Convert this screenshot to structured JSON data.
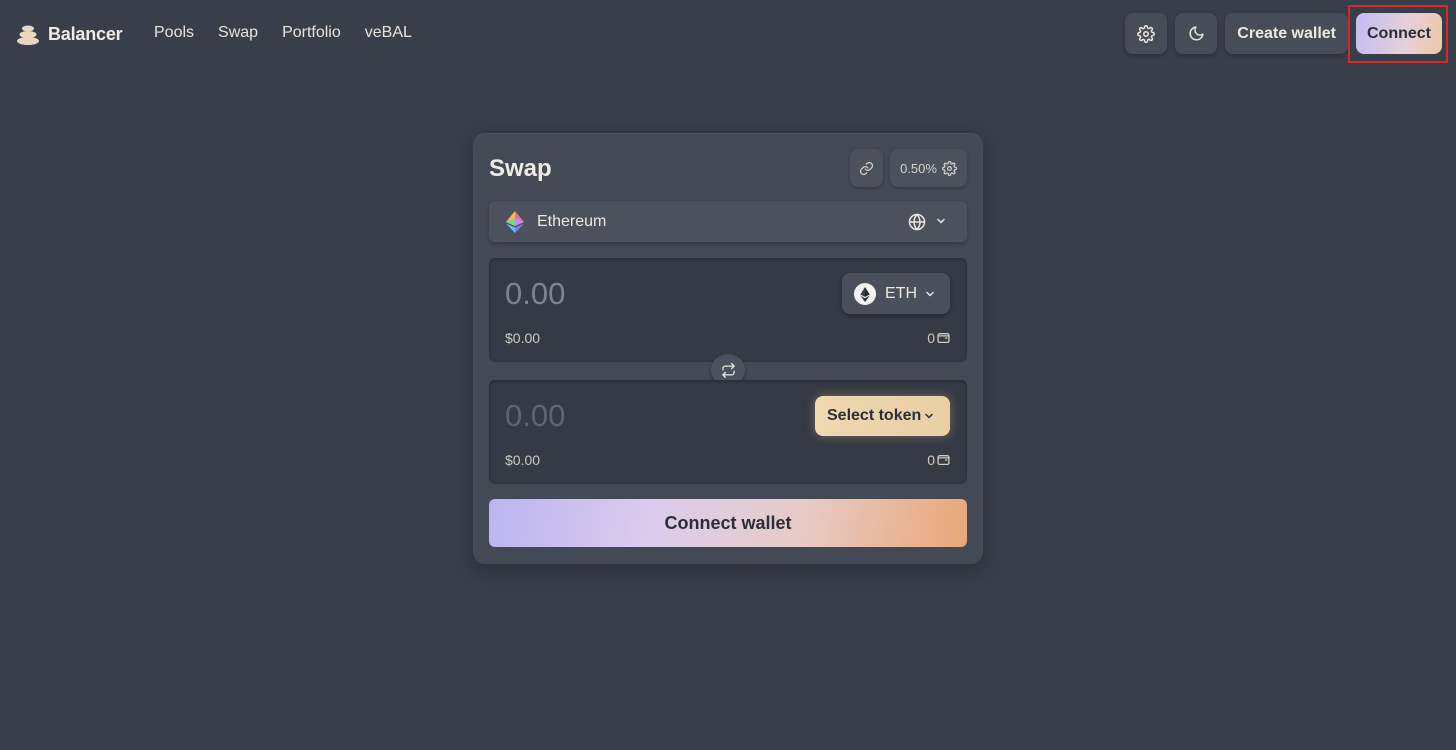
{
  "header": {
    "brand": "Balancer",
    "nav": [
      "Pools",
      "Swap",
      "Portfolio",
      "veBAL"
    ],
    "create_wallet_label": "Create wallet",
    "connect_label": "Connect"
  },
  "swap": {
    "title": "Swap",
    "slippage": "0.50%",
    "network": "Ethereum",
    "from": {
      "amount_placeholder": "0.00",
      "usd": "$0.00",
      "balance": "0",
      "token": "ETH"
    },
    "to": {
      "amount_placeholder": "0.00",
      "usd": "$0.00",
      "balance": "0",
      "token_button": "Select token"
    },
    "connect_wallet_label": "Connect wallet"
  },
  "colors": {
    "background": "#393f4a",
    "card": "#434955",
    "panel": "#353a44",
    "highlight": "#d42a25"
  }
}
